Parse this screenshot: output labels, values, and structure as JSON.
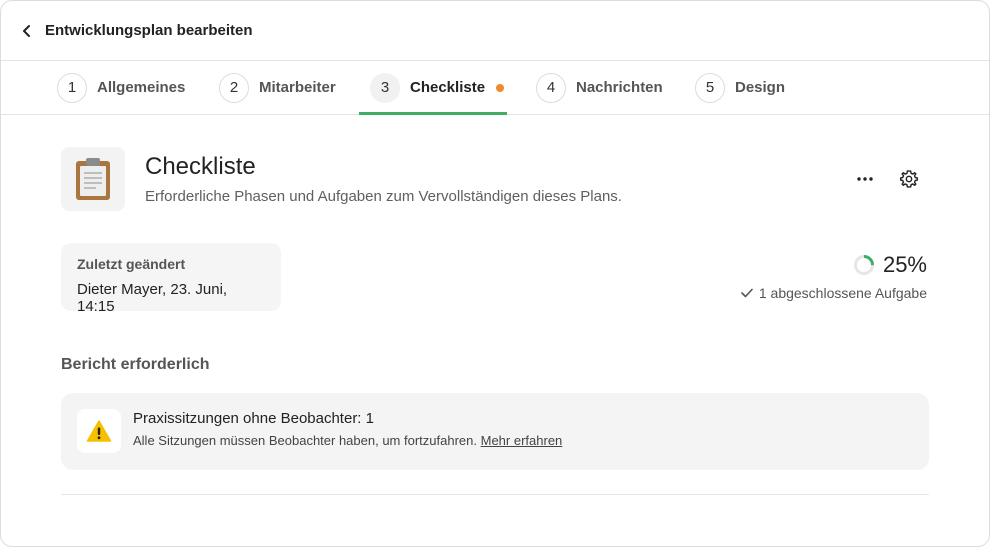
{
  "header": {
    "title": "Entwicklungsplan bearbeiten",
    "back_icon": "chevron-left-icon"
  },
  "tabs": [
    {
      "number": "1",
      "label": "Allgemeines"
    },
    {
      "number": "2",
      "label": "Mitarbeiter"
    },
    {
      "number": "3",
      "label": "Checkliste",
      "active": true,
      "status_dot_color": "#f08a2c"
    },
    {
      "number": "4",
      "label": "Nachrichten"
    },
    {
      "number": "5",
      "label": "Design"
    }
  ],
  "main": {
    "icon": "clipboard-icon",
    "title": "Checkliste",
    "subtitle": "Erforderliche Phasen und Aufgaben zum Vervollständigen dieses Plans.",
    "actions": {
      "more_icon": "more-horizontal-icon",
      "settings_icon": "gear-icon"
    },
    "last_changed": {
      "label": "Zuletzt geändert",
      "value": "Dieter Mayer, 23. Juni, 14:15"
    },
    "progress": {
      "value_text": "25%",
      "fraction": 0.25,
      "completed_text": "1 abgeschlossene Aufgabe"
    },
    "report": {
      "heading": "Bericht erforderlich",
      "warning": {
        "icon": "warning-icon",
        "title": "Praxissitzungen ohne Beobachter: 1",
        "description": "Alle Sitzungen müssen Beobachter haben, um fortzufahren.",
        "link": "Mehr erfahren"
      }
    }
  },
  "colors": {
    "accent": "#3fae63",
    "status_dot": "#f08a2c",
    "warning": "#f5c000"
  }
}
